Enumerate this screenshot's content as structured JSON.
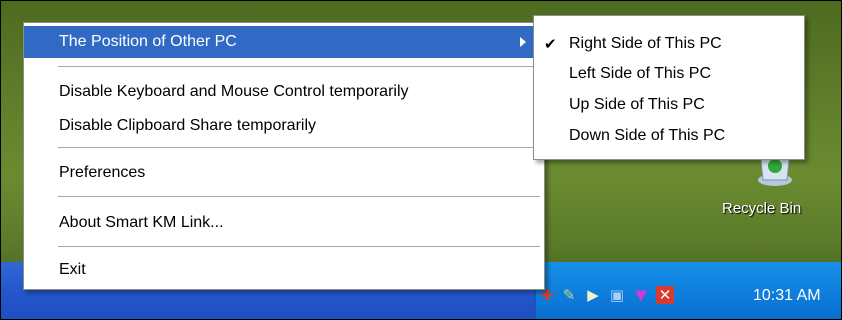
{
  "menu": {
    "items": [
      {
        "label": "The Position of Other PC",
        "has_submenu": true,
        "highlighted": true
      },
      {
        "label": "Disable Keyboard and Mouse Control temporarily"
      },
      {
        "label": "Disable Clipboard Share temporarily"
      },
      {
        "label": "Preferences"
      },
      {
        "label": "About Smart KM Link..."
      },
      {
        "label": "Exit"
      }
    ]
  },
  "submenu": {
    "items": [
      {
        "label": "Right Side of This PC",
        "checked": true
      },
      {
        "label": "Left Side of This PC"
      },
      {
        "label": "Up Side of This PC"
      },
      {
        "label": "Down Side of This PC"
      }
    ]
  },
  "desktop": {
    "recycle_bin_label": "Recycle Bin"
  },
  "taskbar": {
    "clock": "10:31 AM",
    "tray_icons": [
      "red-plus-icon",
      "shield-icon",
      "speaker-icon",
      "network-icon",
      "antivirus-icon",
      "disconnected-icon"
    ]
  },
  "colors": {
    "highlight": "#316ac5",
    "taskbar": "#2457cc",
    "tray": "#0f7fdd"
  }
}
